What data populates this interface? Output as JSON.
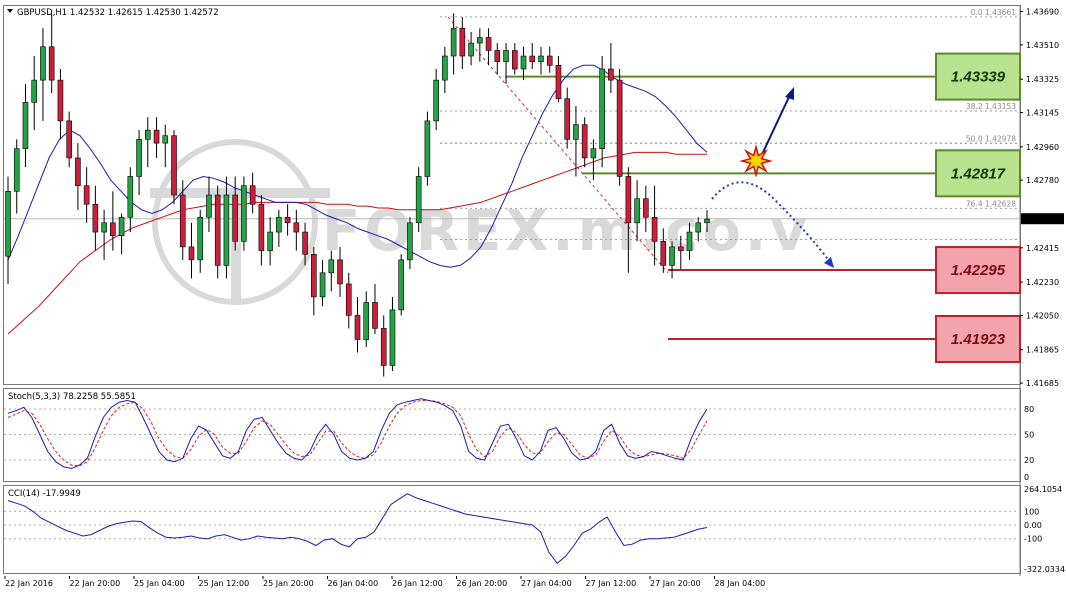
{
  "header": {
    "symbol": "GBPUSD,H1",
    "ohlc": "1.42532 1.42615 1.42530 1.42572"
  },
  "colors": {
    "bull": "#25a244",
    "bear": "#cc1f3c",
    "ma_fast": "#1a1ab8",
    "ma_slow": "#cc1111",
    "resistance": "#5a8a2a",
    "support": "#c0202a",
    "res_box_fill": "#b9e28f",
    "sup_box_fill": "#f4a3aa",
    "stoch_main": "#1a1ab8",
    "stoch_signal": "#dd2222",
    "cci": "#1a1ab8"
  },
  "chart_data": [
    {
      "type": "candlestick",
      "title": "GBPUSD,H1",
      "ylim": [
        1.4168,
        1.4372
      ],
      "current_price_label": "1.42572",
      "y_ticks": [
        "1.43690",
        "1.43510",
        "1.43325",
        "1.43145",
        "1.42960",
        "1.42780",
        "1.42572",
        "1.42415",
        "1.42230",
        "1.42050",
        "1.41865",
        "1.41685"
      ],
      "x_ticks": [
        "22 Jan 2016",
        "22 Jan 20:00",
        "25 Jan 04:00",
        "25 Jan 12:00",
        "25 Jan 20:00",
        "26 Jan 04:00",
        "26 Jan 12:00",
        "26 Jan 20:00",
        "27 Jan 04:00",
        "27 Jan 12:00",
        "27 Jan 20:00",
        "28 Jan 04:00"
      ],
      "candles": [
        [
          1.4237,
          1.428,
          1.4222,
          1.4272
        ],
        [
          1.4272,
          1.43,
          1.426,
          1.4295
        ],
        [
          1.4295,
          1.433,
          1.4285,
          1.432
        ],
        [
          1.432,
          1.4345,
          1.4305,
          1.4332
        ],
        [
          1.4332,
          1.436,
          1.431,
          1.435
        ],
        [
          1.435,
          1.4368,
          1.4325,
          1.4332
        ],
        [
          1.4332,
          1.4338,
          1.43,
          1.431
        ],
        [
          1.431,
          1.4315,
          1.4285,
          1.429
        ],
        [
          1.429,
          1.4298,
          1.4262,
          1.4275
        ],
        [
          1.4275,
          1.4285,
          1.4255,
          1.4265
        ],
        [
          1.4265,
          1.4275,
          1.424,
          1.425
        ],
        [
          1.425,
          1.4262,
          1.4235,
          1.4255
        ],
        [
          1.4255,
          1.4272,
          1.424,
          1.4248
        ],
        [
          1.4248,
          1.426,
          1.4238,
          1.4258
        ],
        [
          1.4258,
          1.4285,
          1.425,
          1.428
        ],
        [
          1.428,
          1.4305,
          1.427,
          1.43
        ],
        [
          1.43,
          1.4312,
          1.4285,
          1.4305
        ],
        [
          1.4305,
          1.4312,
          1.429,
          1.4298
        ],
        [
          1.4298,
          1.4308,
          1.4285,
          1.4302
        ],
        [
          1.4302,
          1.4305,
          1.4265,
          1.427
        ],
        [
          1.427,
          1.4278,
          1.4235,
          1.4242
        ],
        [
          1.4242,
          1.4255,
          1.4225,
          1.4235
        ],
        [
          1.4235,
          1.4262,
          1.4228,
          1.4258
        ],
        [
          1.4258,
          1.428,
          1.425,
          1.427
        ],
        [
          1.427,
          1.4275,
          1.4225,
          1.4232
        ],
        [
          1.4232,
          1.428,
          1.4225,
          1.427
        ],
        [
          1.427,
          1.428,
          1.424,
          1.4245
        ],
        [
          1.4245,
          1.428,
          1.424,
          1.4275
        ],
        [
          1.4275,
          1.4282,
          1.426,
          1.4265
        ],
        [
          1.4265,
          1.427,
          1.4232,
          1.424
        ],
        [
          1.424,
          1.4258,
          1.4232,
          1.425
        ],
        [
          1.425,
          1.4262,
          1.4242,
          1.4258
        ],
        [
          1.4258,
          1.4265,
          1.4248,
          1.4255
        ],
        [
          1.4255,
          1.4262,
          1.424,
          1.425
        ],
        [
          1.425,
          1.4255,
          1.4232,
          1.4238
        ],
        [
          1.4238,
          1.4242,
          1.4205,
          1.4215
        ],
        [
          1.4215,
          1.4235,
          1.421,
          1.4228
        ],
        [
          1.4228,
          1.424,
          1.4218,
          1.4235
        ],
        [
          1.4235,
          1.4242,
          1.4215,
          1.4222
        ],
        [
          1.4222,
          1.4228,
          1.4198,
          1.4205
        ],
        [
          1.4205,
          1.4215,
          1.4185,
          1.4192
        ],
        [
          1.4192,
          1.4218,
          1.4188,
          1.4212
        ],
        [
          1.4212,
          1.4222,
          1.4195,
          1.4198
        ],
        [
          1.4198,
          1.4205,
          1.4172,
          1.4178
        ],
        [
          1.4178,
          1.4215,
          1.4175,
          1.4208
        ],
        [
          1.4208,
          1.4238,
          1.4205,
          1.4235
        ],
        [
          1.4235,
          1.4258,
          1.423,
          1.4255
        ],
        [
          1.4255,
          1.4285,
          1.425,
          1.428
        ],
        [
          1.428,
          1.4315,
          1.4275,
          1.431
        ],
        [
          1.431,
          1.4338,
          1.4305,
          1.4332
        ],
        [
          1.4332,
          1.435,
          1.4325,
          1.4345
        ],
        [
          1.4345,
          1.4368,
          1.4335,
          1.436
        ],
        [
          1.436,
          1.4366,
          1.4338,
          1.4345
        ],
        [
          1.4345,
          1.4358,
          1.434,
          1.4352
        ],
        [
          1.4352,
          1.436,
          1.4342,
          1.4355
        ],
        [
          1.4355,
          1.436,
          1.434,
          1.4348
        ],
        [
          1.4348,
          1.4352,
          1.4335,
          1.4342
        ],
        [
          1.4342,
          1.4352,
          1.433,
          1.4348
        ],
        [
          1.4348,
          1.4352,
          1.4335,
          1.4338
        ],
        [
          1.4338,
          1.435,
          1.4332,
          1.4345
        ],
        [
          1.4345,
          1.4352,
          1.4338,
          1.4342
        ],
        [
          1.4342,
          1.435,
          1.4335,
          1.4345
        ],
        [
          1.4345,
          1.435,
          1.4336,
          1.434
        ],
        [
          1.434,
          1.4345,
          1.432,
          1.4322
        ],
        [
          1.4322,
          1.4328,
          1.4295,
          1.43
        ],
        [
          1.43,
          1.4318,
          1.428,
          1.4308
        ],
        [
          1.4308,
          1.4312,
          1.4285,
          1.429
        ],
        [
          1.429,
          1.43,
          1.4278,
          1.4295
        ],
        [
          1.4295,
          1.4345,
          1.4285,
          1.4338
        ],
        [
          1.4338,
          1.4352,
          1.4325,
          1.4332
        ],
        [
          1.4332,
          1.4338,
          1.4275,
          1.428
        ],
        [
          1.428,
          1.4285,
          1.4228,
          1.4255
        ],
        [
          1.4255,
          1.4278,
          1.4245,
          1.4268
        ],
        [
          1.4268,
          1.4275,
          1.425,
          1.4258
        ],
        [
          1.4258,
          1.4275,
          1.4232,
          1.4245
        ],
        [
          1.4245,
          1.4252,
          1.4228,
          1.4232
        ],
        [
          1.4232,
          1.4245,
          1.4225,
          1.4242
        ],
        [
          1.4242,
          1.4248,
          1.423,
          1.424
        ],
        [
          1.424,
          1.4255,
          1.4235,
          1.425
        ],
        [
          1.425,
          1.4258,
          1.4245,
          1.4255
        ],
        [
          1.4255,
          1.4262,
          1.425,
          1.4257
        ]
      ],
      "ma_fast": [
        1.4235,
        1.4248,
        1.4262,
        1.4276,
        1.429,
        1.43,
        1.4305,
        1.4302,
        1.4295,
        1.4287,
        1.4278,
        1.4272,
        1.4266,
        1.4262,
        1.426,
        1.4262,
        1.4266,
        1.4272,
        1.4278,
        1.428,
        1.4279,
        1.4277,
        1.4274,
        1.4272,
        1.427,
        1.4268,
        1.4266,
        1.4266,
        1.4266,
        1.4265,
        1.4262,
        1.4259,
        1.4257,
        1.4255,
        1.4252,
        1.425,
        1.4248,
        1.4246,
        1.4243,
        1.424,
        1.4237,
        1.4234,
        1.4232,
        1.4231,
        1.4232,
        1.4236,
        1.4242,
        1.4252,
        1.4264,
        1.4276,
        1.429,
        1.4302,
        1.4314,
        1.4324,
        1.4332,
        1.4338,
        1.434,
        1.434,
        1.4337,
        1.4333,
        1.433,
        1.4328,
        1.4326,
        1.4323,
        1.4318,
        1.4312,
        1.4305,
        1.4298,
        1.4293
      ],
      "ma_slow": [
        1.4195,
        1.42,
        1.4205,
        1.421,
        1.4216,
        1.4222,
        1.4228,
        1.4234,
        1.4238,
        1.4242,
        1.4246,
        1.4249,
        1.4252,
        1.4254,
        1.4256,
        1.4258,
        1.426,
        1.4262,
        1.4263,
        1.4264,
        1.4265,
        1.4265,
        1.4265,
        1.4265,
        1.4266,
        1.4266,
        1.4266,
        1.4266,
        1.4266,
        1.4266,
        1.4266,
        1.4265,
        1.4265,
        1.4265,
        1.4264,
        1.4264,
        1.4263,
        1.4263,
        1.4262,
        1.4262,
        1.4262,
        1.4262,
        1.4262,
        1.4263,
        1.4264,
        1.4265,
        1.4266,
        1.4268,
        1.427,
        1.4272,
        1.4274,
        1.4276,
        1.4278,
        1.428,
        1.4282,
        1.4284,
        1.4286,
        1.4288,
        1.429,
        1.4291,
        1.4292,
        1.4293,
        1.4293,
        1.4293,
        1.4293,
        1.4292,
        1.4292,
        1.4292,
        1.4292
      ],
      "fib_levels": [
        {
          "label": "0.0  1.43661",
          "price": 1.43661
        },
        {
          "label": "38.2  1.43153",
          "price": 1.43153
        },
        {
          "label": "50.0  1.42978",
          "price": 1.42978
        },
        {
          "label": "76.4  1.42628",
          "price": 1.42628
        }
      ],
      "levels": [
        {
          "label": "1.43339",
          "value": 1.43339,
          "kind": "resistance"
        },
        {
          "label": "1.42817",
          "value": 1.42817,
          "kind": "resistance"
        },
        {
          "label": "1.42295",
          "value": 1.42295,
          "kind": "support"
        },
        {
          "label": "1.41923",
          "value": 1.41923,
          "kind": "support"
        }
      ],
      "watermark": "FOREX.m.co.v"
    },
    {
      "type": "line",
      "title": "Stoch(5,3,3) 78.2258 55.5851",
      "ylim": [
        0,
        100
      ],
      "y_ticks": [
        "80",
        "50",
        "20",
        "0"
      ],
      "series": [
        {
          "name": "main",
          "values": [
            75,
            78,
            82,
            70,
            50,
            30,
            18,
            12,
            10,
            14,
            22,
            48,
            70,
            82,
            88,
            90,
            88,
            70,
            50,
            30,
            20,
            18,
            22,
            45,
            60,
            55,
            40,
            25,
            22,
            30,
            55,
            68,
            70,
            55,
            40,
            28,
            22,
            20,
            30,
            50,
            62,
            50,
            30,
            22,
            20,
            22,
            30,
            55,
            75,
            85,
            88,
            90,
            92,
            90,
            88,
            84,
            78,
            60,
            30,
            22,
            20,
            40,
            60,
            62,
            45,
            25,
            20,
            30,
            55,
            58,
            45,
            28,
            20,
            22,
            30,
            55,
            62,
            40,
            25,
            22,
            24,
            30,
            28,
            25,
            22,
            20,
            45,
            65,
            80
          ]
        },
        {
          "name": "signal",
          "values": [
            70,
            74,
            78,
            75,
            62,
            45,
            30,
            20,
            14,
            13,
            18,
            35,
            55,
            72,
            82,
            86,
            88,
            80,
            65,
            45,
            32,
            24,
            22,
            32,
            48,
            56,
            50,
            35,
            28,
            28,
            42,
            58,
            66,
            62,
            50,
            38,
            28,
            24,
            26,
            40,
            54,
            54,
            40,
            30,
            24,
            22,
            26,
            40,
            60,
            75,
            84,
            88,
            90,
            90,
            89,
            86,
            82,
            72,
            50,
            32,
            24,
            30,
            48,
            58,
            52,
            38,
            28,
            28,
            42,
            52,
            50,
            38,
            26,
            22,
            26,
            42,
            55,
            48,
            34,
            26,
            24,
            26,
            28,
            27,
            25,
            22,
            32,
            50,
            66
          ]
        }
      ]
    },
    {
      "type": "line",
      "title": "CCI(14) -17.9949",
      "ylim": [
        -322.0334,
        264.1054
      ],
      "y_ticks": [
        "264.1054",
        "100",
        "0.00",
        "-100",
        "-322.0334"
      ],
      "series": [
        {
          "name": "CCI(14)",
          "values": [
            180,
            160,
            140,
            100,
            50,
            20,
            -10,
            -40,
            -60,
            -80,
            -70,
            -40,
            -10,
            10,
            20,
            30,
            25,
            -20,
            -60,
            -90,
            -95,
            -90,
            -80,
            -95,
            -100,
            -80,
            -70,
            -90,
            -110,
            -100,
            -80,
            -90,
            -95,
            -100,
            -90,
            -100,
            -120,
            -150,
            -110,
            -100,
            -140,
            -160,
            -100,
            -90,
            -50,
            50,
            150,
            190,
            230,
            200,
            180,
            160,
            140,
            120,
            100,
            80,
            70,
            60,
            50,
            40,
            30,
            20,
            10,
            0,
            -50,
            -200,
            -280,
            -230,
            -150,
            -60,
            -30,
            20,
            60,
            -50,
            -150,
            -140,
            -110,
            -100,
            -100,
            -95,
            -90,
            -70,
            -50,
            -30,
            -18
          ]
        }
      ]
    }
  ]
}
